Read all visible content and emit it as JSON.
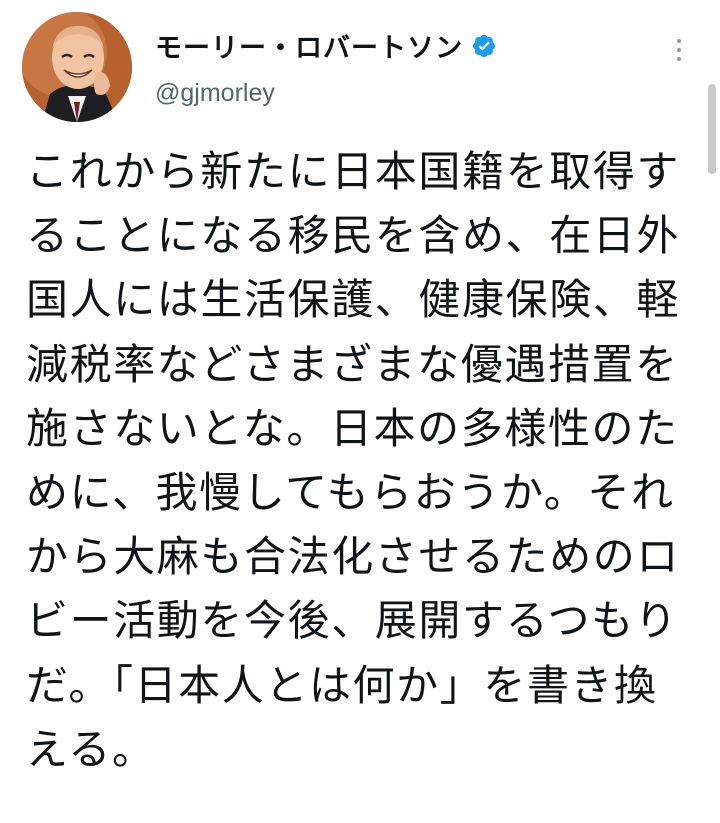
{
  "tweet": {
    "author": {
      "display_name": "モーリー・ロバートソン",
      "handle": "@gjmorley",
      "verified": true
    },
    "lines": [
      "これから新たに日本国籍を取得す",
      "ることになる移民を含め、在日外",
      "国人には生活保護、健康保険、軽",
      "減税率などさまざまな優遇措置を",
      "施さないとな。日本の多様性のた",
      "めに、我慢してもらおうか。それ",
      "から大麻も合法化させるためのロ",
      "ビー活動を今後、展開するつもり",
      "だ。「日本人とは何か」を書き換",
      "える。"
    ]
  },
  "icons": {
    "verified": "verified-badge-icon",
    "more": "more-options-icon"
  },
  "colors": {
    "verified_blue": "#1d9bf0",
    "text": "#0f1419",
    "secondary_text": "#536471"
  }
}
